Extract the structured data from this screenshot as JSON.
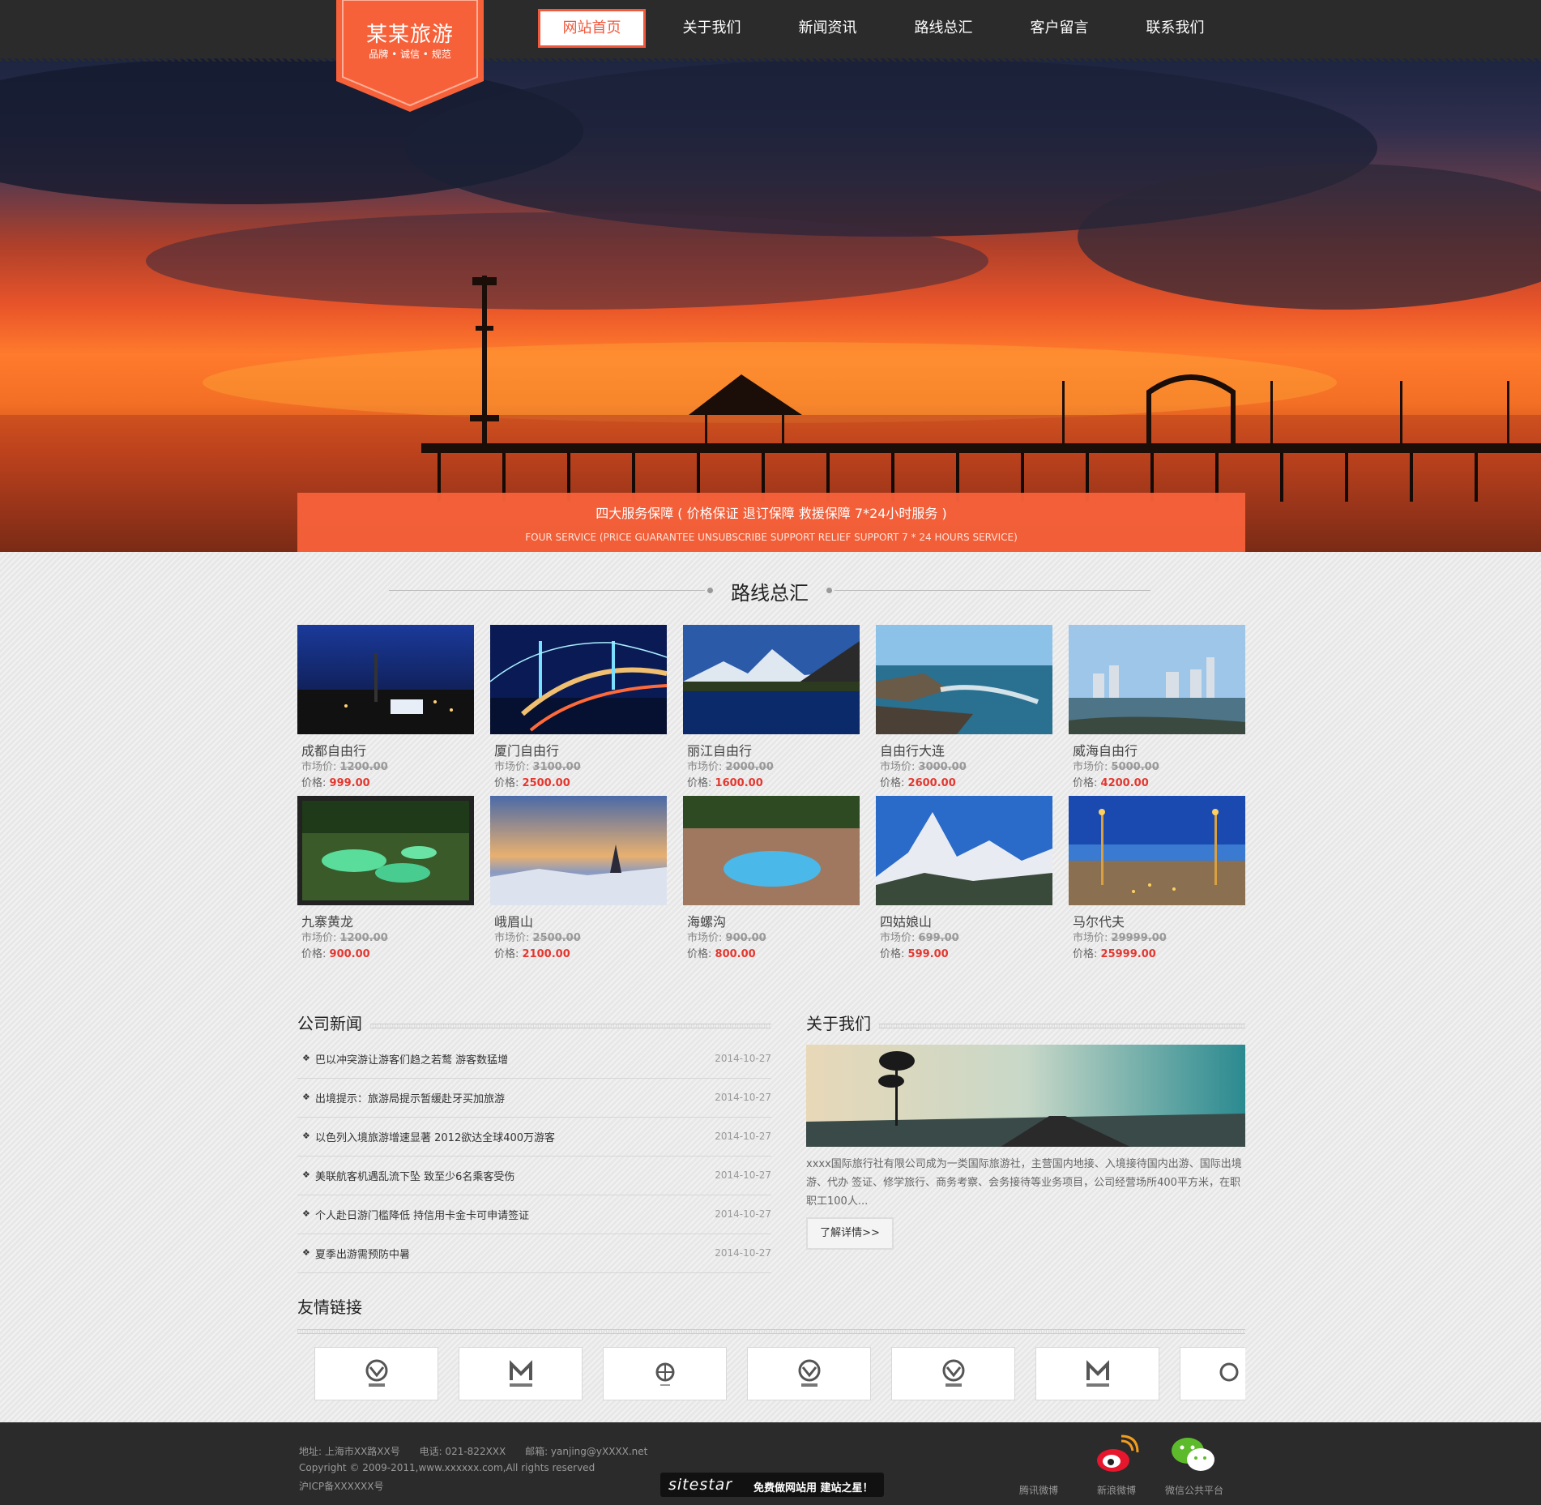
{
  "logo": {
    "title": "某某旅游",
    "subtitle": "品牌 • 诚信 • 规范"
  },
  "nav": [
    {
      "label": "网站首页",
      "active": true
    },
    {
      "label": "关于我们"
    },
    {
      "label": "新闻资讯"
    },
    {
      "label": "路线总汇"
    },
    {
      "label": "客户留言"
    },
    {
      "label": "联系我们"
    }
  ],
  "service": {
    "cn": "四大服务保障 ( 价格保证  退订保障  救援保障  7*24小时服务 )",
    "en": "FOUR SERVICE (PRICE GUARANTEE UNSUBSCRIBE SUPPORT RELIEF SUPPORT 7 * 24 HOURS SERVICE)"
  },
  "routes_title": "路线总汇",
  "market_label": "市场价:",
  "price_label": "价格:",
  "routes": [
    {
      "name": "成都自由行",
      "market": "1200.00",
      "price": "999.00"
    },
    {
      "name": "厦门自由行",
      "market": "3100.00",
      "price": "2500.00"
    },
    {
      "name": "丽江自由行",
      "market": "2000.00",
      "price": "1600.00"
    },
    {
      "name": "自由行大连",
      "market": "3000.00",
      "price": "2600.00"
    },
    {
      "name": "威海自由行",
      "market": "5000.00",
      "price": "4200.00"
    },
    {
      "name": "九寨黄龙",
      "market": "1200.00",
      "price": "900.00"
    },
    {
      "name": "峨眉山",
      "market": "2500.00",
      "price": "2100.00"
    },
    {
      "name": "海螺沟",
      "market": "900.00",
      "price": "800.00"
    },
    {
      "name": "四姑娘山",
      "market": "699.00",
      "price": "599.00"
    },
    {
      "name": "马尔代夫",
      "market": "29999.00",
      "price": "25999.00"
    }
  ],
  "news": {
    "title": "公司新闻",
    "items": [
      {
        "text": "巴以冲突游让游客们趋之若鹜 游客数猛增",
        "date": "2014-10-27"
      },
      {
        "text": "出境提示：旅游局提示暂缓赴牙买加旅游",
        "date": "2014-10-27"
      },
      {
        "text": "以色列入境旅游增速显著 2012欲达全球400万游客",
        "date": "2014-10-27"
      },
      {
        "text": "美联航客机遇乱流下坠 致至少6名乘客受伤",
        "date": "2014-10-27"
      },
      {
        "text": "个人赴日游门槛降低 持信用卡金卡可申请签证",
        "date": "2014-10-27"
      },
      {
        "text": "夏季出游需预防中暑",
        "date": "2014-10-27"
      }
    ]
  },
  "about": {
    "title": "关于我们",
    "text": "xxxx国际旅行社有限公司成为一类国际旅游社，主营国内地接、入境接待国内出游、国际出境游、代办 签证、修学旅行、商务考察、会务接待等业务项目，公司经营场所400平方米，在职职工100人...",
    "button": "了解详情>>"
  },
  "links_title": "友情链接",
  "footer": {
    "address": "地址: 上海市XX路XX号",
    "phone": "电话: 021-822XXX",
    "email": "邮箱: yanjing@yXXXX.net",
    "copyright": "Copyright © 2009-2011,www.xxxxxx.com,All rights reserved",
    "icp": "沪ICP备XXXXXX号",
    "badge_logo": "sitestar",
    "badge_text": "免费做网站用 建站之星！",
    "social": [
      {
        "label": "腾讯微博",
        "icon": "tencent-weibo-icon"
      },
      {
        "label": "新浪微博",
        "icon": "sina-weibo-icon"
      },
      {
        "label": "微信公共平台",
        "icon": "wechat-icon"
      }
    ]
  },
  "colors": {
    "accent": "#f6613a",
    "price": "#e4372f",
    "dark": "#2b2b2b"
  }
}
